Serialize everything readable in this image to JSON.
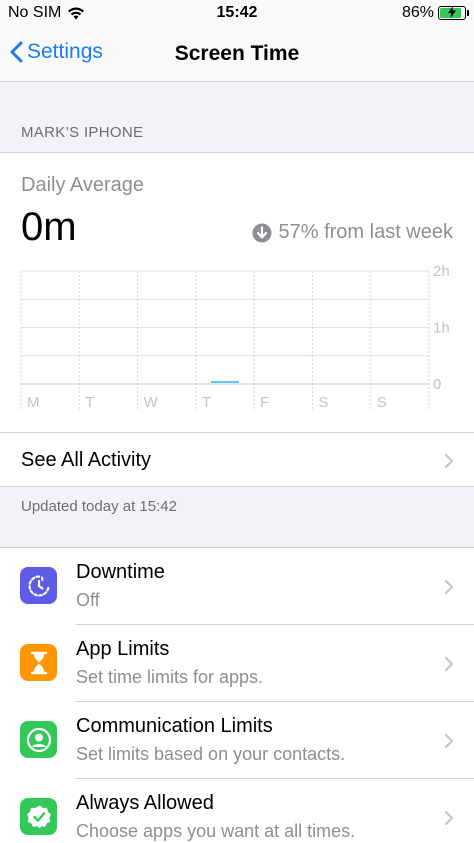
{
  "status": {
    "carrier": "No SIM",
    "time": "15:42",
    "battery": "86%",
    "battery_level": 0.86
  },
  "nav": {
    "back_label": "Settings",
    "title": "Screen Time"
  },
  "device": {
    "header": "MARK’S IPHONE"
  },
  "summary": {
    "daily_label": "Daily Average",
    "daily_value": "0m",
    "change_text": "57% from last week"
  },
  "chart_data": {
    "type": "bar",
    "categories": [
      "M",
      "T",
      "W",
      "T",
      "F",
      "S",
      "S"
    ],
    "values": [
      0,
      0,
      0,
      0.02,
      0,
      0,
      0
    ],
    "y_ticks": [
      "2h",
      "1h",
      "0"
    ],
    "ylim": [
      0,
      2
    ],
    "bar_color": "#5ac8fa"
  },
  "see_all": {
    "label": "See All Activity"
  },
  "updated": "Updated today at 15:42",
  "items": [
    {
      "title": "Downtime",
      "subtitle": "Off",
      "icon": "downtime-icon",
      "color": "#5e5ce6"
    },
    {
      "title": "App Limits",
      "subtitle": "Set time limits for apps.",
      "icon": "hourglass-icon",
      "color": "#ff9500"
    },
    {
      "title": "Communication Limits",
      "subtitle": "Set limits based on your contacts.",
      "icon": "person-circle-icon",
      "color": "#34c759"
    },
    {
      "title": "Always Allowed",
      "subtitle": "Choose apps you want at all times.",
      "icon": "checkmark-seal-icon",
      "color": "#34c759"
    }
  ]
}
